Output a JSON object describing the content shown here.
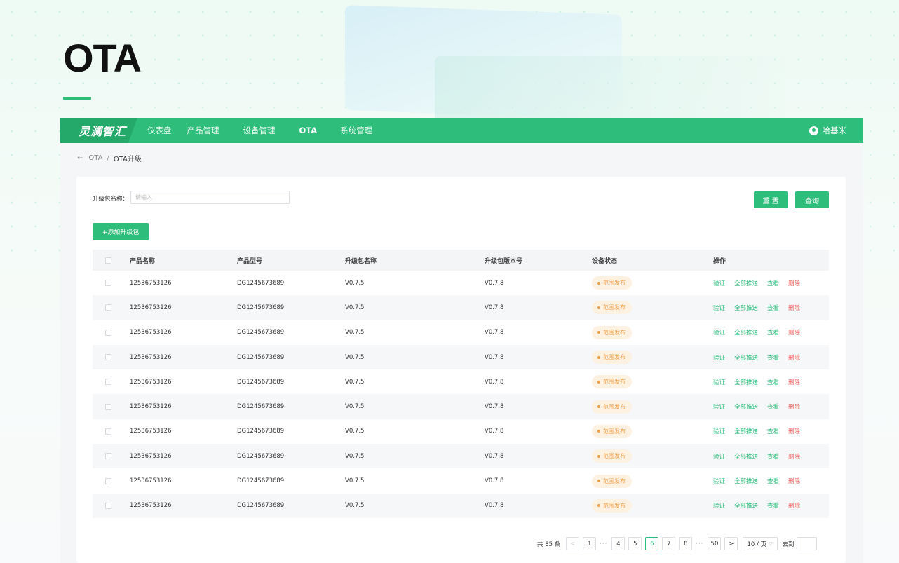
{
  "page": {
    "title": "OTA"
  },
  "navbar": {
    "brand": "灵澜智汇",
    "items": [
      "仪表盘",
      "产品管理",
      "设备管理",
      "OTA",
      "系统管理"
    ],
    "active": "OTA",
    "user": "哈基米"
  },
  "breadcrumb": {
    "back": "←",
    "parent": "OTA",
    "separator": "/",
    "current": "OTA升级"
  },
  "filter": {
    "label": "升级包名称：",
    "placeholder": "请输入",
    "value": ""
  },
  "buttons": {
    "reset": "重 置",
    "query": "查询",
    "add": "+添加升级包"
  },
  "table": {
    "columns": [
      "产品名称",
      "产品型号",
      "升级包名称",
      "升级包版本号",
      "设备状态",
      "操作"
    ],
    "rows": [
      {
        "name": "12536753126",
        "model": "DG1245673689",
        "pkg": "V0.7.5",
        "version": "V0.7.8",
        "status": "范围发布"
      },
      {
        "name": "12536753126",
        "model": "DG1245673689",
        "pkg": "V0.7.5",
        "version": "V0.7.8",
        "status": "范围发布"
      },
      {
        "name": "12536753126",
        "model": "DG1245673689",
        "pkg": "V0.7.5",
        "version": "V0.7.8",
        "status": "范围发布"
      },
      {
        "name": "12536753126",
        "model": "DG1245673689",
        "pkg": "V0.7.5",
        "version": "V0.7.8",
        "status": "范围发布"
      },
      {
        "name": "12536753126",
        "model": "DG1245673689",
        "pkg": "V0.7.5",
        "version": "V0.7.8",
        "status": "范围发布"
      },
      {
        "name": "12536753126",
        "model": "DG1245673689",
        "pkg": "V0.7.5",
        "version": "V0.7.8",
        "status": "范围发布"
      },
      {
        "name": "12536753126",
        "model": "DG1245673689",
        "pkg": "V0.7.5",
        "version": "V0.7.8",
        "status": "范围发布"
      },
      {
        "name": "12536753126",
        "model": "DG1245673689",
        "pkg": "V0.7.5",
        "version": "V0.7.8",
        "status": "范围发布"
      },
      {
        "name": "12536753126",
        "model": "DG1245673689",
        "pkg": "V0.7.5",
        "version": "V0.7.8",
        "status": "范围发布"
      },
      {
        "name": "12536753126",
        "model": "DG1245673689",
        "pkg": "V0.7.5",
        "version": "V0.7.8",
        "status": "范围发布"
      }
    ],
    "actions": [
      "验证",
      "全部推送",
      "查看",
      "删除"
    ]
  },
  "pagination": {
    "total_text": "共 85 条",
    "prev": "<",
    "next": ">",
    "pages": [
      "1",
      "···",
      "4",
      "5",
      "6",
      "7",
      "8",
      "···",
      "50"
    ],
    "current": "6",
    "page_size": "10 / 页",
    "goto_label": "去到"
  },
  "colors": {
    "accent": "#2ebd7b",
    "danger": "#f05a5a",
    "warning": "#f0a04b"
  }
}
